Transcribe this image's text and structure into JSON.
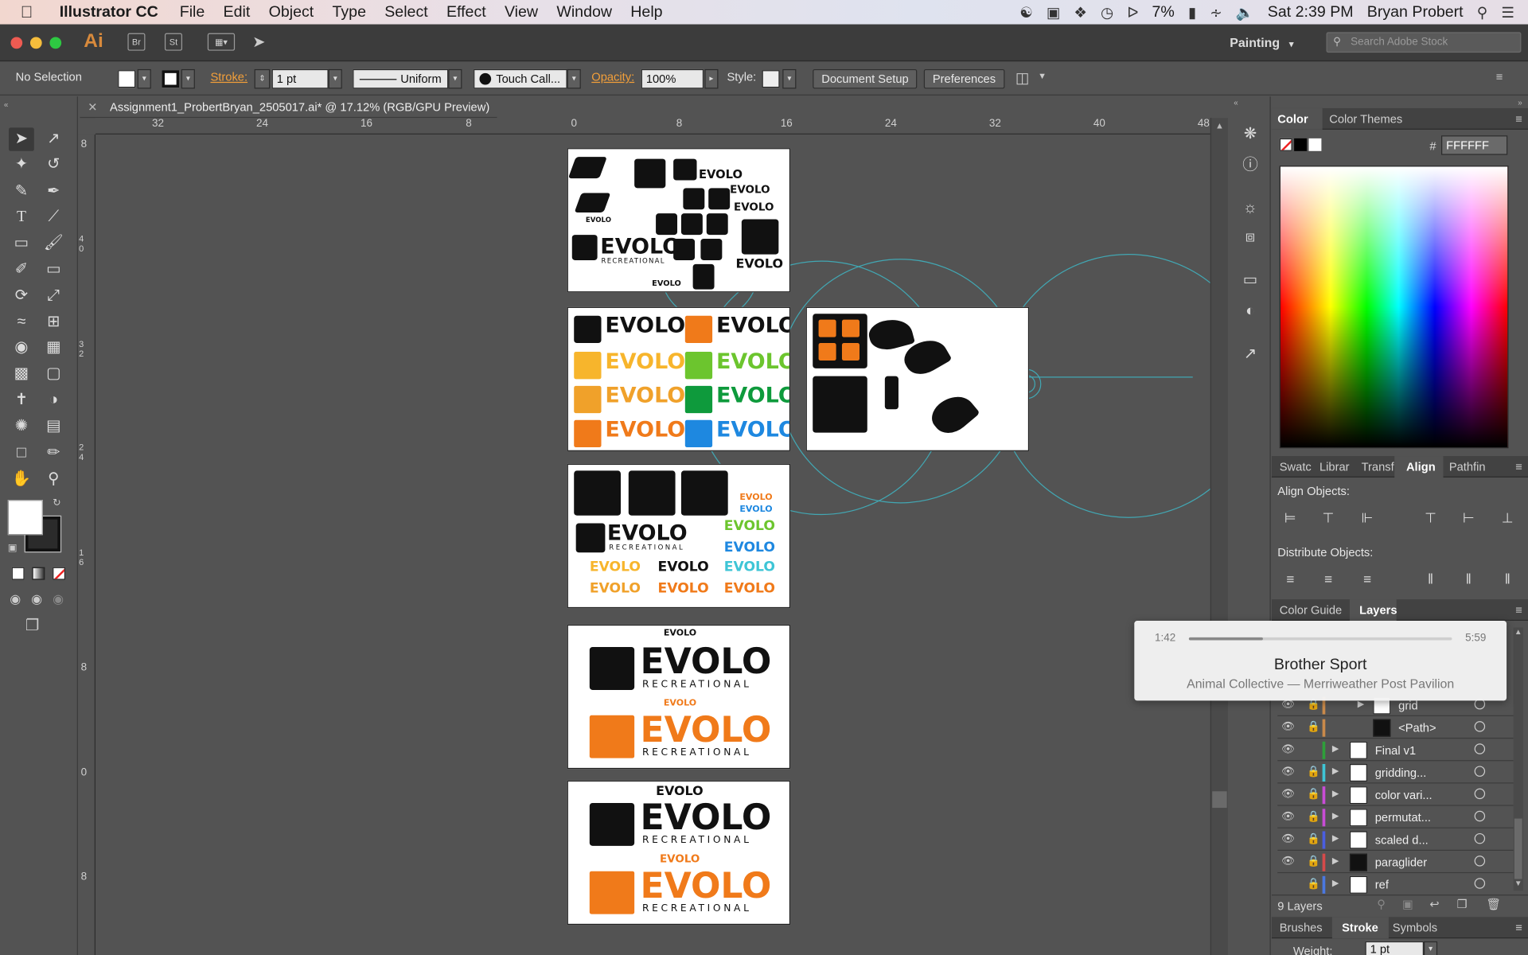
{
  "menubar": {
    "app_name": "Illustrator CC",
    "items": [
      "File",
      "Edit",
      "Object",
      "Type",
      "Select",
      "Effect",
      "View",
      "Window",
      "Help"
    ],
    "battery": "7%",
    "clock": "Sat 2:39 PM",
    "user": "Bryan Probert"
  },
  "appbar": {
    "logo": "Ai",
    "bridge": "Br",
    "stock_btn": "St",
    "workspace": "Painting",
    "search_placeholder": "Search Adobe Stock"
  },
  "control": {
    "selection": "No Selection",
    "stroke_label": "Stroke:",
    "stroke_value": "1 pt",
    "profile": "Uniform",
    "brush": "Touch Call...",
    "opacity_label": "Opacity:",
    "opacity_value": "100%",
    "style_label": "Style:",
    "document_setup": "Document Setup",
    "preferences": "Preferences"
  },
  "document": {
    "tab_title": "Assignment1_ProbertBryan_2505017.ai* @ 17.12% (RGB/GPU Preview)",
    "ruler_top": [
      "32",
      "24",
      "16",
      "8",
      "0",
      "8",
      "16",
      "24",
      "32",
      "40",
      "48"
    ],
    "ruler_left": [
      "8",
      "4 0",
      "3 2",
      "2 4",
      "1 6",
      "8",
      "0",
      "8"
    ]
  },
  "artwork": {
    "brand": "EVOLO",
    "tagline": "RECREATIONAL"
  },
  "color_panel": {
    "tab_color": "Color",
    "tab_themes": "Color Themes",
    "hash": "#",
    "hex": "FFFFFF"
  },
  "align_panel": {
    "tabs": [
      "Swatc",
      "Librar",
      "Transf",
      "Align",
      "Pathfin"
    ],
    "align_objects": "Align Objects:",
    "distribute_objects": "Distribute Objects:"
  },
  "layers_panel": {
    "tab_guide": "Color Guide",
    "tab_layers": "Layers",
    "rows": [
      {
        "name": "grid",
        "color": "#c98a4a"
      },
      {
        "name": "<Path>",
        "color": "#c98a4a"
      },
      {
        "name": "Final v1",
        "color": "#2e9f3a"
      },
      {
        "name": "gridding...",
        "color": "#3ec5d6"
      },
      {
        "name": "color vari...",
        "color": "#c84cd6"
      },
      {
        "name": "permutat...",
        "color": "#c84cd6"
      },
      {
        "name": "scaled d...",
        "color": "#4a5ee0"
      },
      {
        "name": "paraglider",
        "color": "#d64a4a"
      },
      {
        "name": "ref",
        "color": "#4a78e0"
      }
    ],
    "count": "9 Layers"
  },
  "bottom_tabs": [
    "Brushes",
    "Stroke",
    "Symbols"
  ],
  "stroke_weight_label": "Weight:",
  "stroke_weight_value": "1 pt",
  "now_playing": {
    "elapsed": "1:42",
    "duration": "5:59",
    "progress": 0.28,
    "title": "Brother Sport",
    "subtitle": "Animal Collective — Merriweather Post Pavilion"
  },
  "colors": {
    "accent_orange": "#f07a1a",
    "ui_dark": "#535353"
  }
}
